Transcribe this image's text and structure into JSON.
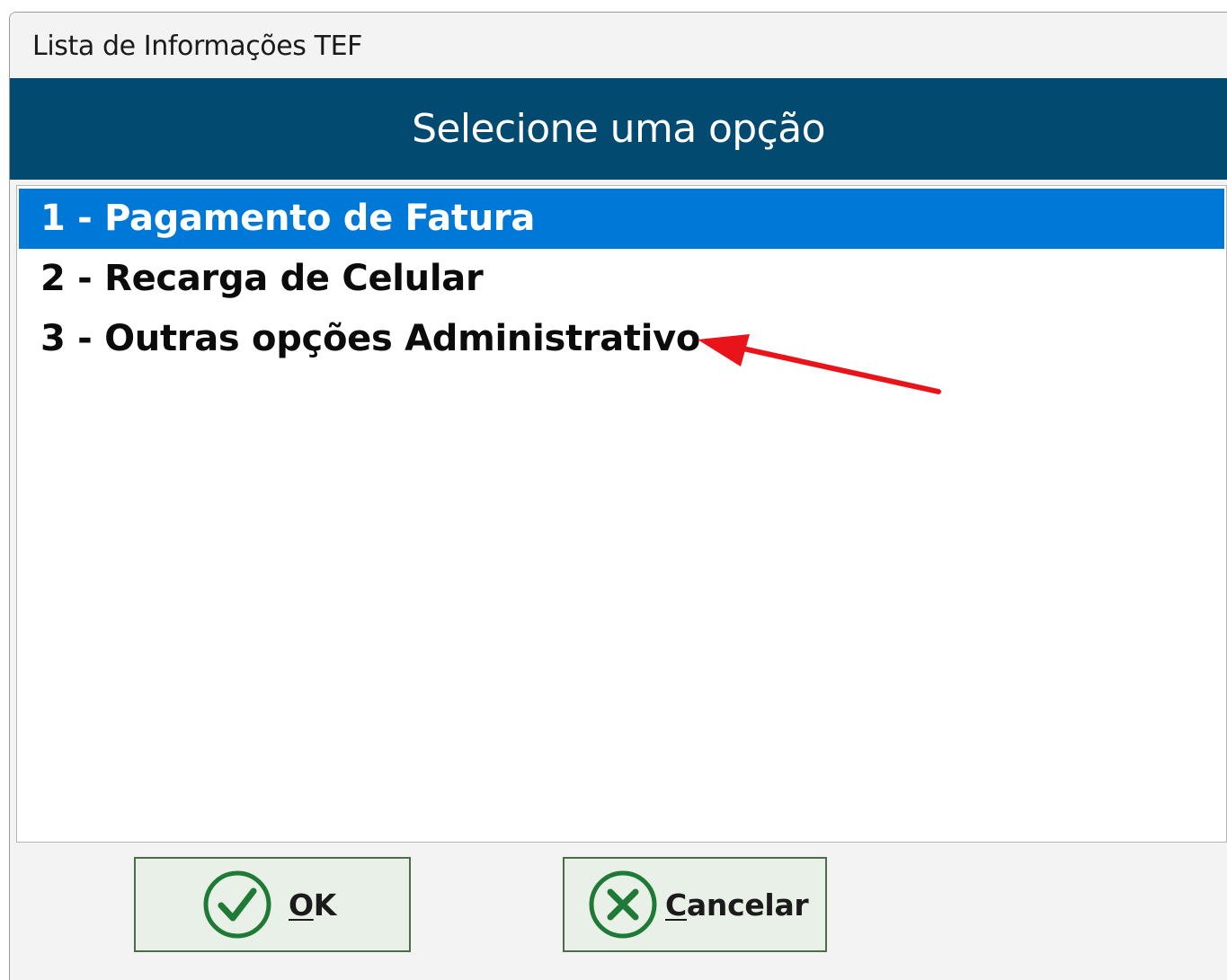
{
  "window": {
    "title": "Lista de Informações TEF"
  },
  "header": {
    "text": "Selecione uma opção"
  },
  "options": [
    {
      "label": "1 - Pagamento de Fatura",
      "selected": true
    },
    {
      "label": "2 - Recarga de Celular",
      "selected": false
    },
    {
      "label": "3 - Outras opções Administrativo",
      "selected": false
    }
  ],
  "buttons": {
    "ok": {
      "mnemonic": "O",
      "rest": "K",
      "icon": "check-circle-icon"
    },
    "cancel": {
      "mnemonic": "C",
      "rest": "ancelar",
      "icon": "x-circle-icon"
    }
  },
  "colors": {
    "header_bg": "#024a6f",
    "selection_bg": "#0078d7",
    "icon_green": "#1f7a36",
    "annotation_arrow": "#e8141a"
  },
  "annotation": {
    "icon": "red-arrow-icon"
  }
}
